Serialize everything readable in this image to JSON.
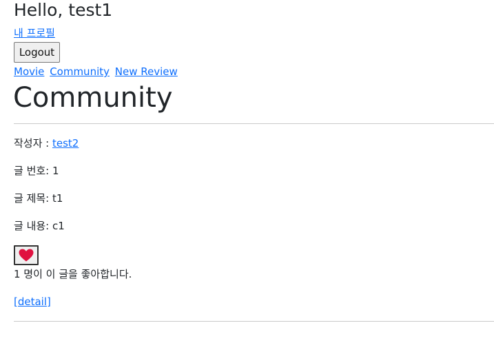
{
  "header": {
    "greeting": "Hello, test1",
    "profile_link": "내 프로필",
    "logout_label": "Logout"
  },
  "nav": {
    "items": [
      {
        "label": "Movie"
      },
      {
        "label": "Community"
      },
      {
        "label": "New Review"
      }
    ]
  },
  "main": {
    "title": "Community"
  },
  "post": {
    "author_label": "작성자 : ",
    "author": "test2",
    "number_text": "글 번호: 1",
    "title_text": "글 제목: t1",
    "content_text": "글 내용: c1",
    "like_icon": "heart-icon",
    "like_color": "#e0103f",
    "like_count_text": "1 명이 이 글을 좋아합니다.",
    "detail_link": "[detail]"
  }
}
